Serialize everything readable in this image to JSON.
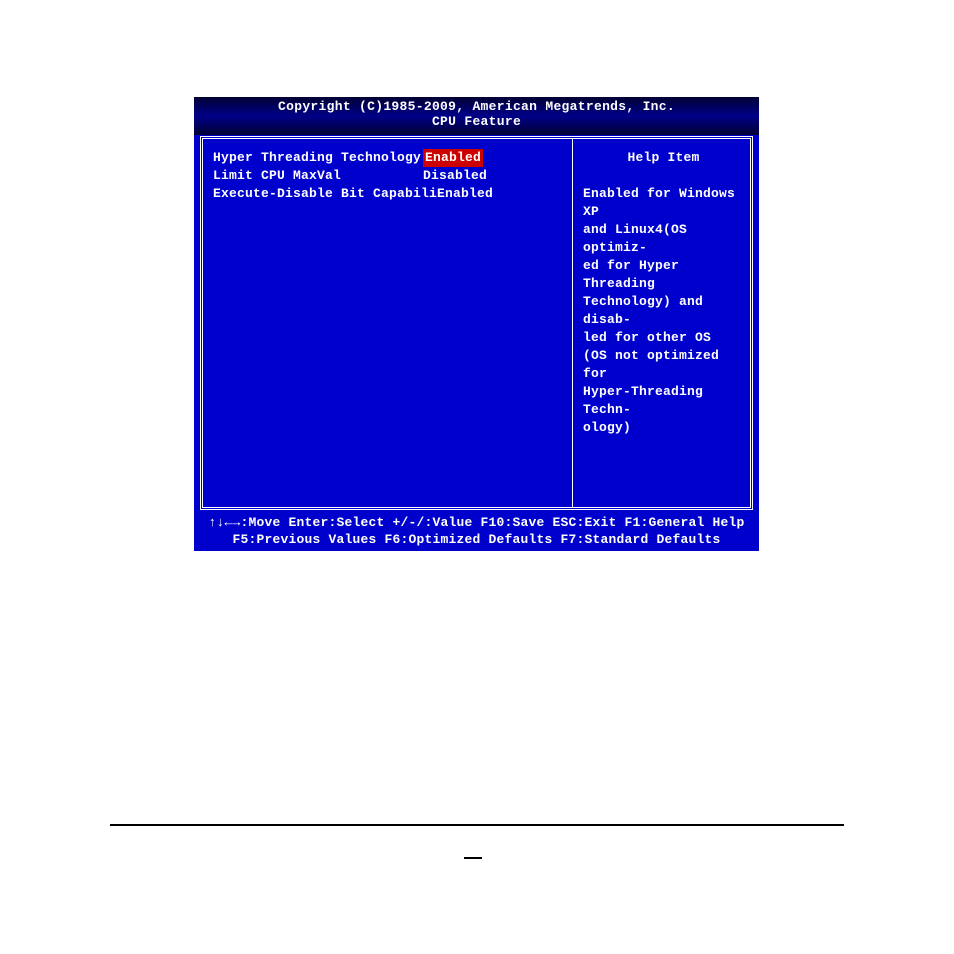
{
  "header": {
    "copyright": "Copyright (C)1985-2009, American Megatrends, Inc.",
    "title": "CPU Feature"
  },
  "settings": [
    {
      "label": "Hyper Threading Technology",
      "value": "Enabled",
      "selected": true
    },
    {
      "label": "Limit CPU MaxVal",
      "value": "Disabled",
      "selected": false
    },
    {
      "label": "Execute-Disable Bit Capabili",
      "value": "Enabled",
      "selected": false
    }
  ],
  "help": {
    "title": "Help Item",
    "text": "Enabled for Windows XP\nand Linux4(OS optimiz-\ned for Hyper Threading\nTechnology) and disab-\nled for other OS\n(OS not optimized for\nHyper-Threading Techn-\nology)"
  },
  "footer": {
    "line1": "↑↓←→:Move  Enter:Select  +/-/:Value  F10:Save  ESC:Exit  F1:General Help",
    "line2": "F5:Previous Values    F6:Optimized Defaults    F7:Standard Defaults"
  }
}
